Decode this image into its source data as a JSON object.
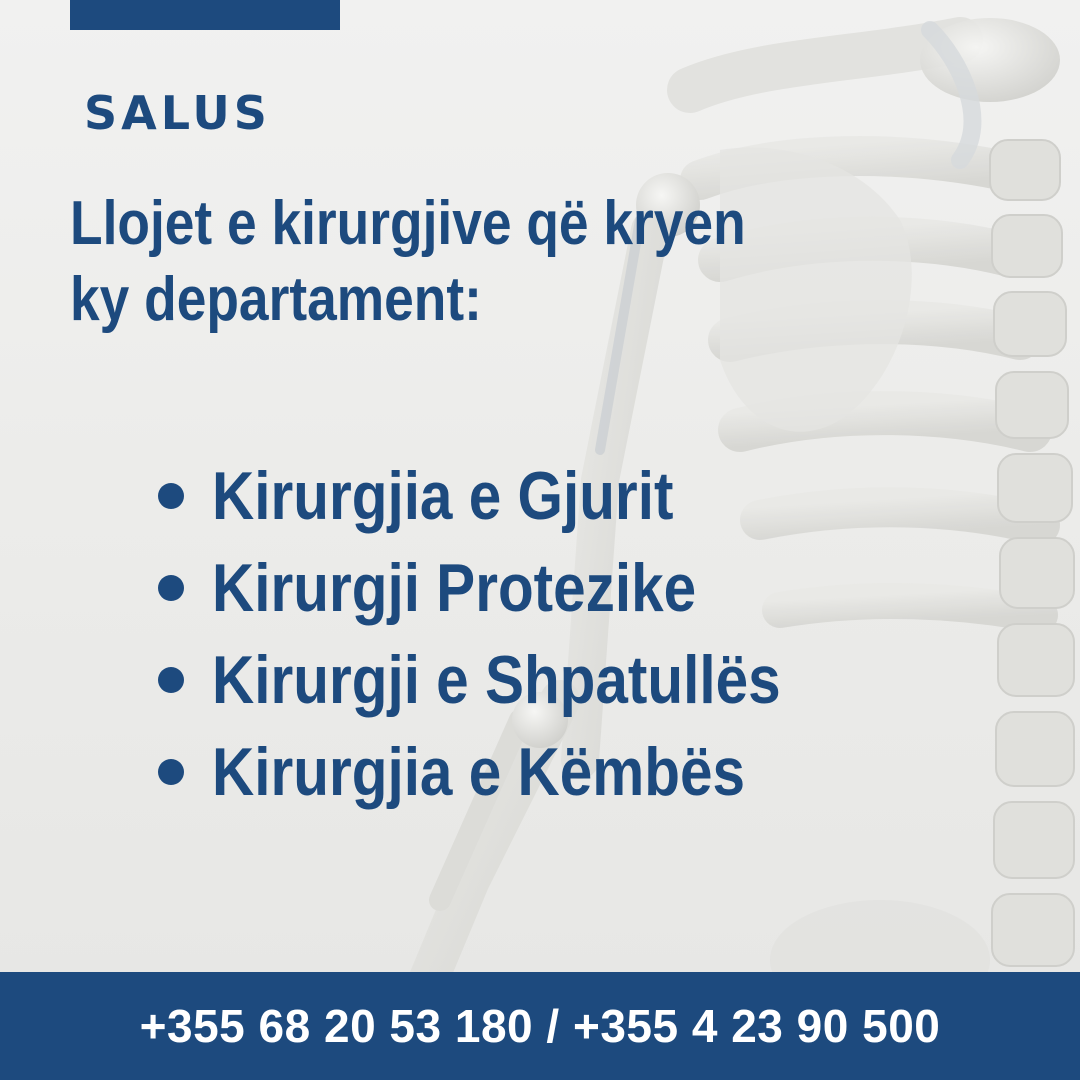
{
  "brand": {
    "name": "SALUS"
  },
  "headline": {
    "line1": "Llojet e kirurgjive që kryen",
    "line2": "ky departament:"
  },
  "surgeries": [
    {
      "label": "Kirurgjia e Gjurit"
    },
    {
      "label": "Kirurgji Protezike"
    },
    {
      "label": "Kirurgji e Shpatullës"
    },
    {
      "label": "Kirurgjia e Këmbës"
    }
  ],
  "footer": {
    "phones": "+355 68 20 53 180 / +355 4 23 90 500"
  },
  "colors": {
    "brand_blue": "#1d4a7e",
    "background": "#ececea",
    "bone": "#dededa"
  }
}
